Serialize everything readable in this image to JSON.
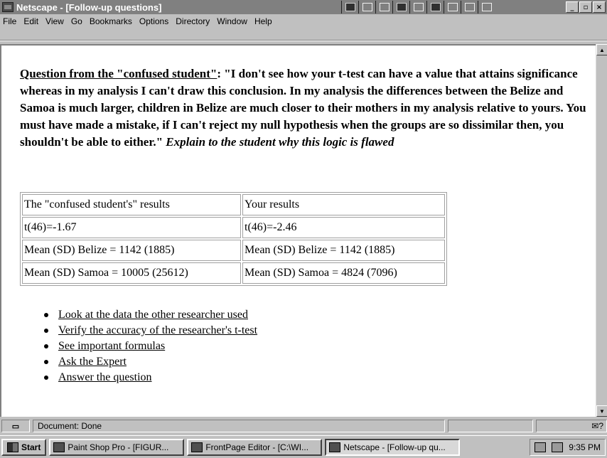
{
  "window": {
    "title": "Netscape - [Follow-up questions]"
  },
  "menu": [
    {
      "label": "File"
    },
    {
      "label": "Edit"
    },
    {
      "label": "View"
    },
    {
      "label": "Go"
    },
    {
      "label": "Bookmarks"
    },
    {
      "label": "Options"
    },
    {
      "label": "Directory"
    },
    {
      "label": "Window"
    },
    {
      "label": "Help"
    }
  ],
  "content": {
    "question_label": "Question from the \"confused student\"",
    "question_body": ": \"I don't see how your t-test can have a value that attains significance whereas in my analysis I can't draw this conclusion. In my analysis the differences between the Belize and Samoa is much larger, children in Belize are much closer to their mothers in my analysis relative to yours. You must have made a mistake, if I can't reject my null hypothesis when the groups are so dissimilar then, you shouldn't be able to either.\" ",
    "question_instruction": "Explain to the student why this logic is flawed"
  },
  "table": {
    "rows": [
      [
        "The \"confused student's\" results",
        "Your results"
      ],
      [
        "t(46)=-1.67",
        "t(46)=-2.46"
      ],
      [
        "Mean (SD) Belize = 1142 (1885)",
        "Mean (SD) Belize = 1142 (1885)"
      ],
      [
        "Mean (SD) Samoa = 10005 (25612)",
        "Mean (SD) Samoa = 4824 (7096)"
      ]
    ]
  },
  "links": [
    "Look at the data the other researcher used",
    "Verify the accuracy of the researcher's t-test",
    "See important formulas",
    "Ask the Expert",
    "Answer the question"
  ],
  "status": {
    "text": "Document: Done"
  },
  "taskbar": {
    "start_label": "Start",
    "tasks": [
      {
        "label": "Paint Shop Pro - [FIGUR...",
        "active": false
      },
      {
        "label": "FrontPage Editor - [C:\\WI...",
        "active": false
      },
      {
        "label": "Netscape - [Follow-up qu...",
        "active": true
      }
    ],
    "clock": "9:35 PM"
  }
}
